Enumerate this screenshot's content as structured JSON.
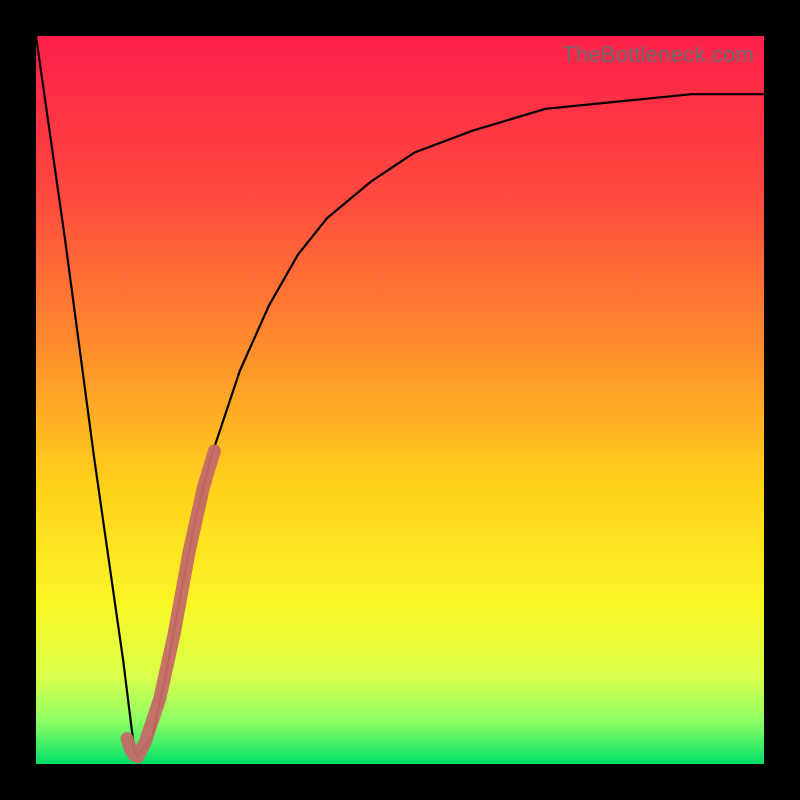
{
  "watermark": {
    "text": "TheBottleneck.com"
  },
  "colors": {
    "frame_bg": "#000000",
    "curve": "#000000",
    "highlight": "#c46a66",
    "watermark": "#6c6c6c",
    "gradient_stops": [
      {
        "pct": 0,
        "color": "#ff1f4b"
      },
      {
        "pct": 22,
        "color": "#ff4a3e"
      },
      {
        "pct": 42,
        "color": "#ff8a2d"
      },
      {
        "pct": 62,
        "color": "#ffd21a"
      },
      {
        "pct": 78,
        "color": "#faf625"
      },
      {
        "pct": 88,
        "color": "#d9ff4a"
      },
      {
        "pct": 94,
        "color": "#8fff63"
      },
      {
        "pct": 100,
        "color": "#00e06a"
      }
    ]
  },
  "chart_data": {
    "type": "line",
    "title": "",
    "xlabel": "",
    "ylabel": "",
    "xlim": [
      0,
      100
    ],
    "ylim": [
      0,
      100
    ],
    "series": [
      {
        "name": "bottleneck-curve",
        "x": [
          0,
          4,
          8,
          10,
          12,
          13,
          13.5,
          14,
          16,
          18,
          20,
          22,
          24,
          28,
          32,
          36,
          40,
          46,
          52,
          60,
          70,
          80,
          90,
          100
        ],
        "y": [
          100,
          72,
          42,
          28,
          14,
          6,
          2,
          1,
          4,
          13,
          24,
          34,
          42,
          54,
          63,
          70,
          75,
          80,
          84,
          87,
          90,
          91,
          92,
          92
        ]
      },
      {
        "name": "highlight-range",
        "x": [
          12.5,
          13,
          13.5,
          14,
          15,
          17,
          19,
          21,
          23,
          24.5
        ],
        "y": [
          3.5,
          2,
          1.2,
          1,
          3,
          9,
          18,
          29,
          38,
          43
        ]
      }
    ]
  }
}
